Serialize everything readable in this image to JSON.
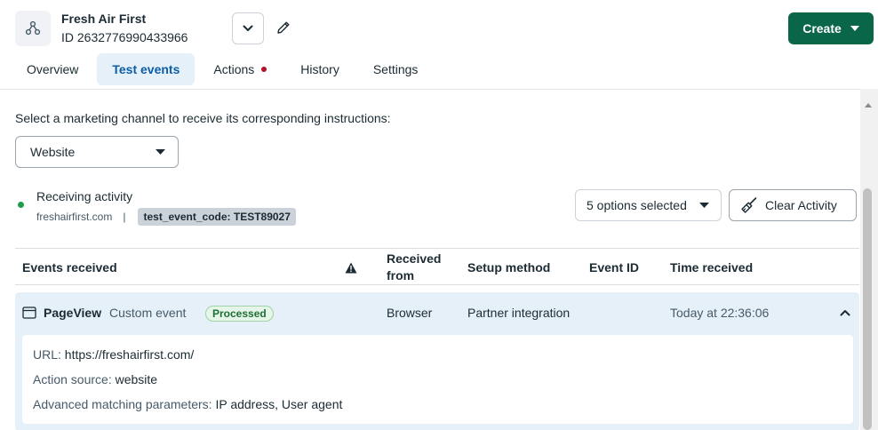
{
  "header": {
    "dataset_name": "Fresh Air First",
    "dataset_id": "ID 2632776990433966",
    "create_label": "Create"
  },
  "tabs": [
    {
      "label": "Overview"
    },
    {
      "label": "Test events",
      "active": true
    },
    {
      "label": "Actions",
      "badge": true
    },
    {
      "label": "History"
    },
    {
      "label": "Settings"
    }
  ],
  "channel": {
    "prompt": "Select a marketing channel to receive its corresponding instructions:",
    "selected": "Website"
  },
  "activity": {
    "title": "Receiving activity",
    "domain": "freshairfirst.com",
    "separator": "|",
    "code": "test_event_code: TEST89027",
    "status_color": "#1e9e4a"
  },
  "filters": {
    "options_label": "5 options selected",
    "clear_label": "Clear Activity"
  },
  "table": {
    "headers": {
      "events": "Events received",
      "warning": "warning-icon",
      "received_from": "Received from",
      "setup": "Setup method",
      "event_id": "Event ID",
      "time": "Time received"
    },
    "rows": [
      {
        "event": "PageView",
        "type": "Custom event",
        "status": "Processed",
        "received_from": "Browser",
        "setup": "Partner integration",
        "event_id": "",
        "time": "Today at 22:36:06",
        "details": {
          "url_key": "URL:",
          "url_val": "https://freshairfirst.com/",
          "source_key": "Action source:",
          "source_val": "website",
          "params_key": "Advanced matching parameters:",
          "params_val": "IP address, User agent"
        }
      }
    ]
  },
  "colors": {
    "accent": "#0a6649",
    "tab_active": "#0a5ea8",
    "row_bg": "#e6f0f8",
    "alert_dot": "#b3122a"
  }
}
